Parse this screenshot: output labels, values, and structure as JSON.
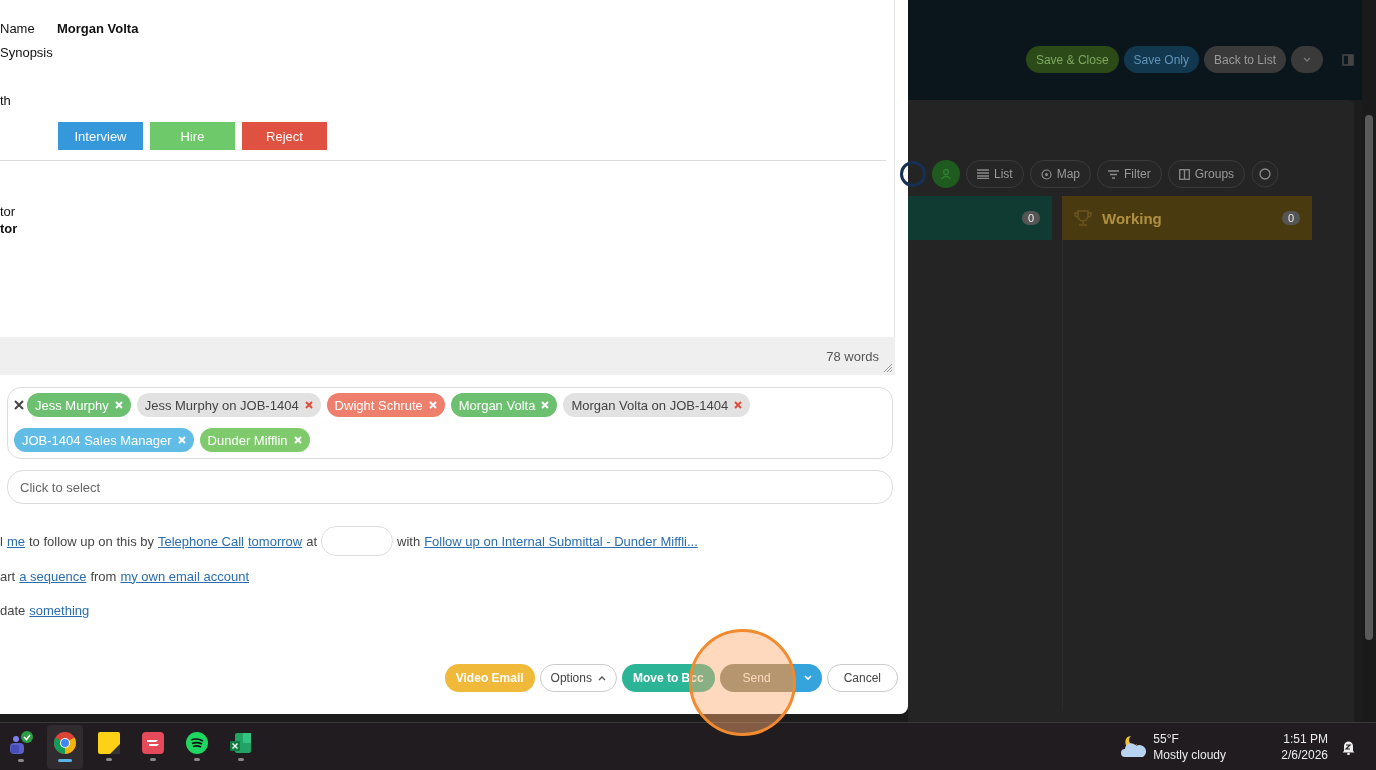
{
  "record": {
    "fields": [
      {
        "label": "Name",
        "value": "Morgan Volta"
      },
      {
        "label": "Synopsis"
      },
      {
        "label": "th"
      }
    ],
    "actions": [
      {
        "label": "Interview",
        "kind": "interview"
      },
      {
        "label": "Hire",
        "kind": "hire"
      },
      {
        "label": "Reject",
        "kind": "reject"
      }
    ],
    "lines": [
      {
        "text": "tor",
        "bold": false
      },
      {
        "text": "tor",
        "bold": true
      }
    ]
  },
  "editor": {
    "word_count": "78 words"
  },
  "recipients": {
    "tags": [
      {
        "label": "Jess Murphy",
        "kind": "solid",
        "color": "#6cc070"
      },
      {
        "label": "Jess Murphy on JOB-1404",
        "kind": "soft",
        "color": "#e2e2e2"
      },
      {
        "label": "Dwight Schrute",
        "kind": "solid",
        "color": "#ee7f6c"
      },
      {
        "label": "Morgan Volta",
        "kind": "solid",
        "color": "#6cc070"
      },
      {
        "label": "Morgan Volta on JOB-1404",
        "kind": "soft",
        "color": "#e2e2e2"
      },
      {
        "label": "JOB-1404 Sales Manager",
        "kind": "solid",
        "color": "#62bde6"
      },
      {
        "label": "Dunder Mifflin",
        "kind": "solid",
        "color": "#7fca6c"
      }
    ]
  },
  "cc_field": {
    "placeholder": "Click to select"
  },
  "automation": [
    [
      {
        "kind": "text",
        "text": "l"
      },
      {
        "kind": "link",
        "text": "me"
      },
      {
        "kind": "text",
        "text": "to follow up on this by"
      },
      {
        "kind": "link",
        "text": "Telephone Call"
      },
      {
        "kind": "link",
        "text": "tomorrow"
      },
      {
        "kind": "text",
        "text": "at"
      },
      {
        "kind": "field"
      },
      {
        "kind": "text",
        "text": "with"
      },
      {
        "kind": "link",
        "text": "Follow up on Internal Submittal - Dunder Miffli..."
      }
    ],
    [
      {
        "kind": "text",
        "text": "art"
      },
      {
        "kind": "link",
        "text": "a sequence"
      },
      {
        "kind": "text",
        "text": "from"
      },
      {
        "kind": "link",
        "text": "my own email account"
      }
    ],
    [
      {
        "kind": "text",
        "text": "date"
      },
      {
        "kind": "link",
        "text": "something"
      }
    ]
  ],
  "footer": [
    {
      "label": "Video Email",
      "kind": "video"
    },
    {
      "label": "Options",
      "kind": "options"
    },
    {
      "label": "Move to Bcc",
      "kind": "bcc"
    },
    {
      "label": "Send",
      "kind": "send"
    },
    {
      "label": "Cancel",
      "kind": "cancel"
    }
  ],
  "background": {
    "actions": [
      {
        "label": "Save & Close",
        "kind": "save-close"
      },
      {
        "label": "Save Only",
        "kind": "save"
      },
      {
        "label": "Back to List",
        "kind": "back"
      }
    ],
    "views": [
      {
        "label": "List",
        "kind": "list"
      },
      {
        "label": "Map",
        "kind": "map"
      },
      {
        "label": "Filter",
        "kind": "filter"
      },
      {
        "label": "Groups",
        "kind": "groups"
      }
    ],
    "columns": [
      {
        "count": "0",
        "color": "#0f3b33"
      },
      {
        "title": "Working",
        "count": "0",
        "color": "#4a3a10"
      }
    ]
  },
  "taskbar": {
    "apps": [
      {
        "kind": "teams",
        "selected": false
      },
      {
        "kind": "chrome",
        "selected": true
      },
      {
        "kind": "notes",
        "selected": false
      },
      {
        "kind": "todo",
        "selected": false
      },
      {
        "kind": "music",
        "selected": false
      },
      {
        "kind": "excel",
        "selected": false
      }
    ],
    "weather": {
      "temp": "55°F",
      "text": "Mostly cloudy"
    },
    "time": "1:51 PM",
    "date": "2/6/2026"
  }
}
